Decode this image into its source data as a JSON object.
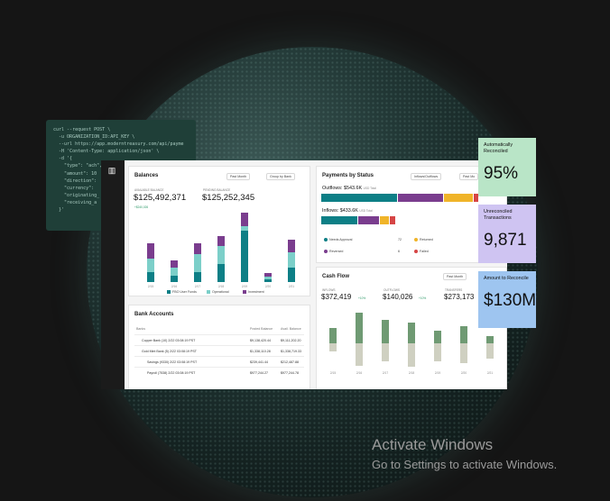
{
  "code_lines": [
    "curl --request POST \\",
    "  -u ORGANIZATION_ID:API_KEY \\",
    "  --url https://app.moderntreasury.com/api/payme",
    "  -H 'Content-Type: application/json' \\",
    "  -d '{",
    "    \"type\": \"ach\",",
    "    \"amount\": 10",
    "    \"direction\":",
    "    \"currency\":",
    "    \"originating_",
    "    \"receiving_a",
    "  }'"
  ],
  "balances": {
    "title": "Balances",
    "period": "Past Month",
    "group": "Group by Bank",
    "available_label": "Available Balance",
    "available": "$125,492,371",
    "available_change": "+$240,026",
    "pending_label": "Pending Balance",
    "pending": "$125,252,345",
    "legend": [
      "FBO User Funds",
      "Operational",
      "Investment"
    ],
    "colors": [
      "#0d7f86",
      "#7ccfc9",
      "#7a3d8e"
    ]
  },
  "chart_data": {
    "type": "bar",
    "stacked": true,
    "categories": [
      "2/15",
      "2/16",
      "2/17",
      "2/18",
      "2/19",
      "2/20",
      "2/21"
    ],
    "series": [
      {
        "name": "FBO User Funds",
        "values": [
          8,
          5,
          8,
          14,
          40,
          2,
          11
        ]
      },
      {
        "name": "Operational",
        "values": [
          10,
          6,
          14,
          14,
          4,
          2,
          12
        ]
      },
      {
        "name": "Investment",
        "values": [
          12,
          6,
          8,
          8,
          10,
          3,
          10
        ]
      }
    ],
    "ylim": [
      0,
      55
    ]
  },
  "cashflow_data": {
    "type": "bar",
    "categories": [
      "2/15",
      "2/16",
      "2/17",
      "2/18",
      "2/19",
      "2/20",
      "2/21"
    ],
    "series": [
      {
        "name": "Inflows",
        "values": [
          11,
          22,
          17,
          15,
          9,
          12,
          5
        ]
      },
      {
        "name": "Outflows",
        "values": [
          -6,
          -16,
          -13,
          -17,
          -13,
          -14,
          -11
        ]
      }
    ]
  },
  "bank_accounts": {
    "title": "Bank Accounts",
    "columns": [
      "Banks",
      "Posted Balance",
      "Avail. Balance"
    ],
    "rows": [
      {
        "name": "Copper Bank (10) 2/22 03:08:19 PST",
        "posted": "$9,138,420.44",
        "avail": "$9,111,202.20"
      },
      {
        "name": "Gold Mint Bank (5) 2/22 03:08:19 PST",
        "posted": "$1,338,110.28",
        "avail": "$1,338,719.33"
      },
      {
        "name": "Savings (9330) 2/22 03:08:19 PST",
        "posted": "$239,441.44",
        "avail": "$212,487.88"
      },
      {
        "name": "Payroll (7538) 2/22 03:08:19 PST",
        "posted": "$977,244.27",
        "avail": "$977,244.78"
      }
    ]
  },
  "payments": {
    "title": "Payments by Status",
    "filter": "Inflows/Outflows",
    "period": "Past Mo",
    "outflows_label": "Outflows: $543.6K",
    "outflows_unit": "USD Total",
    "inflows_label": "Inflows: $433.6K",
    "inflows_unit": "USD Total",
    "outflow_segments": [
      {
        "color": "#0d7f86",
        "w": 84
      },
      {
        "color": "#7a3d8e",
        "w": 50
      },
      {
        "color": "#f0b429",
        "w": 32
      },
      {
        "color": "#d64545",
        "w": 5
      }
    ],
    "inflow_segments": [
      {
        "color": "#0d7f86",
        "w": 40
      },
      {
        "color": "#7a3d8e",
        "w": 23
      },
      {
        "color": "#f0b429",
        "w": 10
      },
      {
        "color": "#d64545",
        "w": 6
      }
    ],
    "statuses": [
      {
        "name": "Needs Approval",
        "count": "72",
        "color": "#0d7f86"
      },
      {
        "name": "Returned",
        "count": "",
        "color": "#f0b429"
      },
      {
        "name": "Reversed",
        "count": "6",
        "color": "#7a3d8e"
      },
      {
        "name": "Failed",
        "count": "",
        "color": "#d64545"
      }
    ]
  },
  "cashflow": {
    "title": "Cash Flow",
    "period": "Past Month",
    "inflows_label": "Inflows",
    "inflows": "$372,419",
    "inflows_change": "+10%",
    "outflows_label": "Outflows",
    "outflows": "$140,026",
    "outflows_change": "+10%",
    "transfers_label": "Transfers",
    "transfers": "$273,173",
    "colors": [
      "#6f9a73",
      "#cfd0c1"
    ]
  },
  "stats": [
    {
      "label": "Automatically Reconciled",
      "value": "95%",
      "color": "#b9e5c7"
    },
    {
      "label": "Unreconciled Transactions",
      "value": "9,871",
      "color": "#cfc4f2"
    },
    {
      "label": "Amount to Reconcile",
      "value": "$130M",
      "color": "#9ec5f0"
    }
  ],
  "watermark": {
    "title": "Activate Windows",
    "subtitle": "Go to Settings to activate Windows."
  }
}
